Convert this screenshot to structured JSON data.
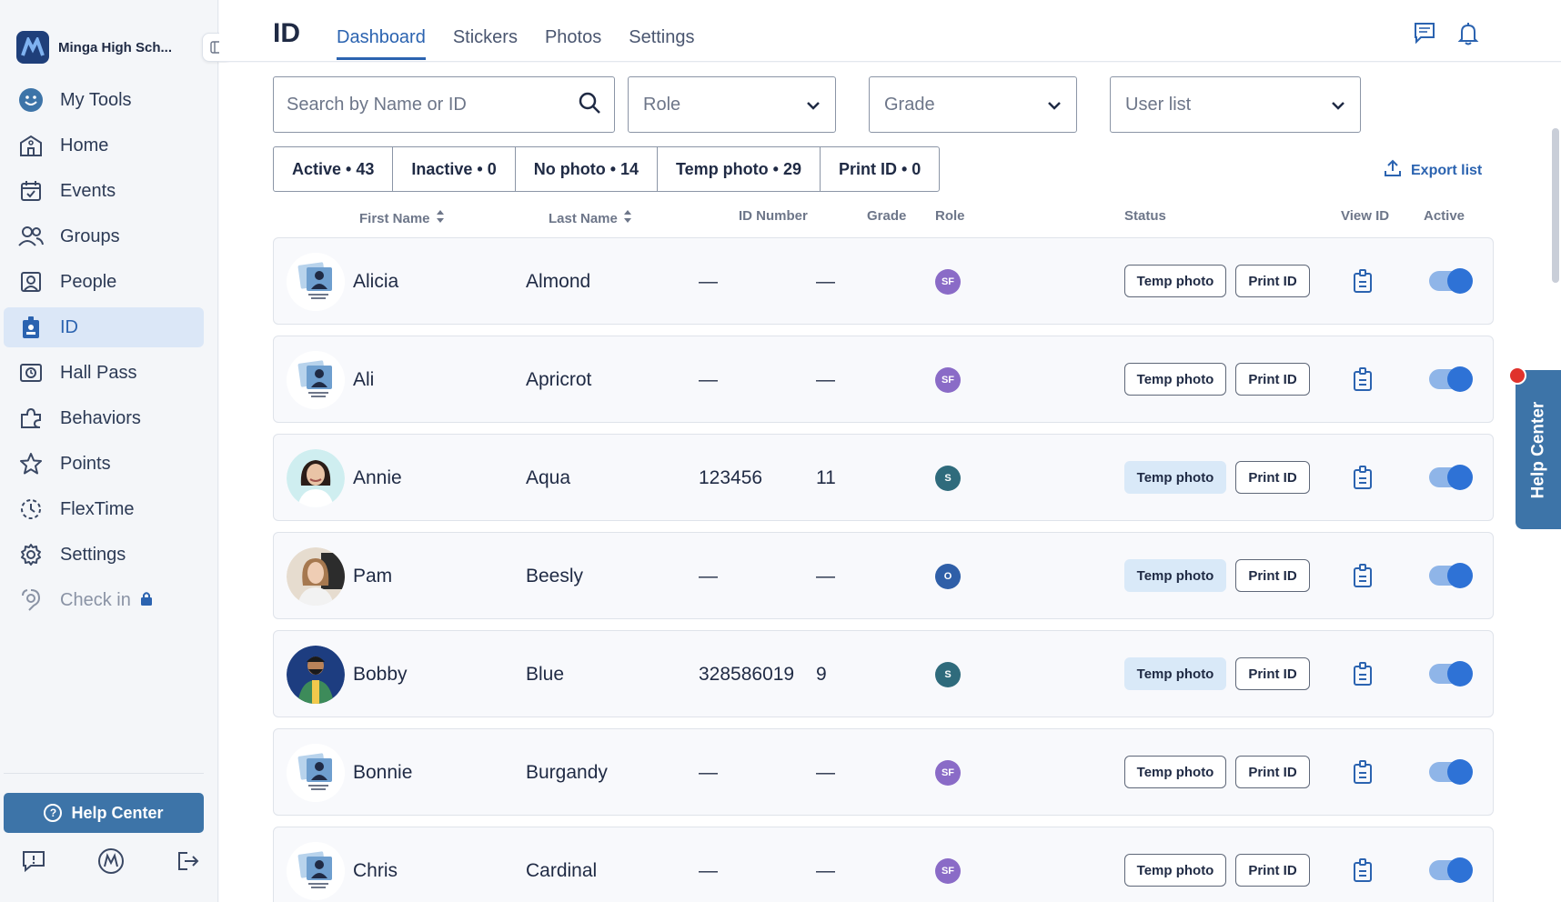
{
  "sidebar": {
    "school_name": "Minga High Sch...",
    "items": [
      {
        "label": "My Tools",
        "icon": "smiley-icon"
      },
      {
        "label": "Home",
        "icon": "school-icon"
      },
      {
        "label": "Events",
        "icon": "calendar-icon"
      },
      {
        "label": "Groups",
        "icon": "groups-icon"
      },
      {
        "label": "People",
        "icon": "person-card-icon"
      },
      {
        "label": "ID",
        "icon": "id-badge-icon"
      },
      {
        "label": "Hall Pass",
        "icon": "hall-pass-icon"
      },
      {
        "label": "Behaviors",
        "icon": "puzzle-icon"
      },
      {
        "label": "Points",
        "icon": "star-icon"
      },
      {
        "label": "FlexTime",
        "icon": "flextime-icon"
      },
      {
        "label": "Settings",
        "icon": "gear-icon"
      },
      {
        "label": "Check in",
        "icon": "checkin-icon"
      }
    ],
    "help_label": "Help Center"
  },
  "header": {
    "title": "ID",
    "tabs": [
      "Dashboard",
      "Stickers",
      "Photos",
      "Settings"
    ]
  },
  "filters": {
    "search_placeholder": "Search by Name or ID",
    "role_label": "Role",
    "grade_label": "Grade",
    "userlist_label": "User list"
  },
  "chips": [
    "Active • 43",
    "Inactive • 0",
    "No photo • 14",
    "Temp photo • 29",
    "Print ID • 0"
  ],
  "export_label": "Export list",
  "columns": {
    "first_name": "First Name",
    "last_name": "Last Name",
    "id_number": "ID Number",
    "grade": "Grade",
    "role": "Role",
    "status": "Status",
    "view_id": "View ID",
    "active": "Active"
  },
  "rows": [
    {
      "first": "Alicia",
      "last": "Almond",
      "id": "—",
      "grade": "—",
      "role": "SF",
      "photo": "none"
    },
    {
      "first": "Ali",
      "last": "Apricrot",
      "id": "—",
      "grade": "—",
      "role": "SF",
      "photo": "none"
    },
    {
      "first": "Annie",
      "last": "Aqua",
      "id": "123456",
      "grade": "11",
      "role": "S",
      "photo": "woman"
    },
    {
      "first": "Pam",
      "last": "Beesly",
      "id": "—",
      "grade": "—",
      "role": "O",
      "photo": "woman2"
    },
    {
      "first": "Bobby",
      "last": "Blue",
      "id": "328586019",
      "grade": "9",
      "role": "S",
      "photo": "man"
    },
    {
      "first": "Bonnie",
      "last": "Burgandy",
      "id": "—",
      "grade": "—",
      "role": "SF",
      "photo": "none"
    },
    {
      "first": "Chris",
      "last": "Cardinal",
      "id": "—",
      "grade": "—",
      "role": "SF",
      "photo": "none"
    }
  ],
  "row_buttons": {
    "temp": "Temp photo",
    "print": "Print ID"
  },
  "help_tab_label": "Help Center",
  "colors": {
    "accent": "#2b63b0",
    "help": "#3d74a8",
    "role_sf": "#8a6bc7",
    "role_s": "#2f6b7c",
    "role_o": "#2f5fa8"
  }
}
